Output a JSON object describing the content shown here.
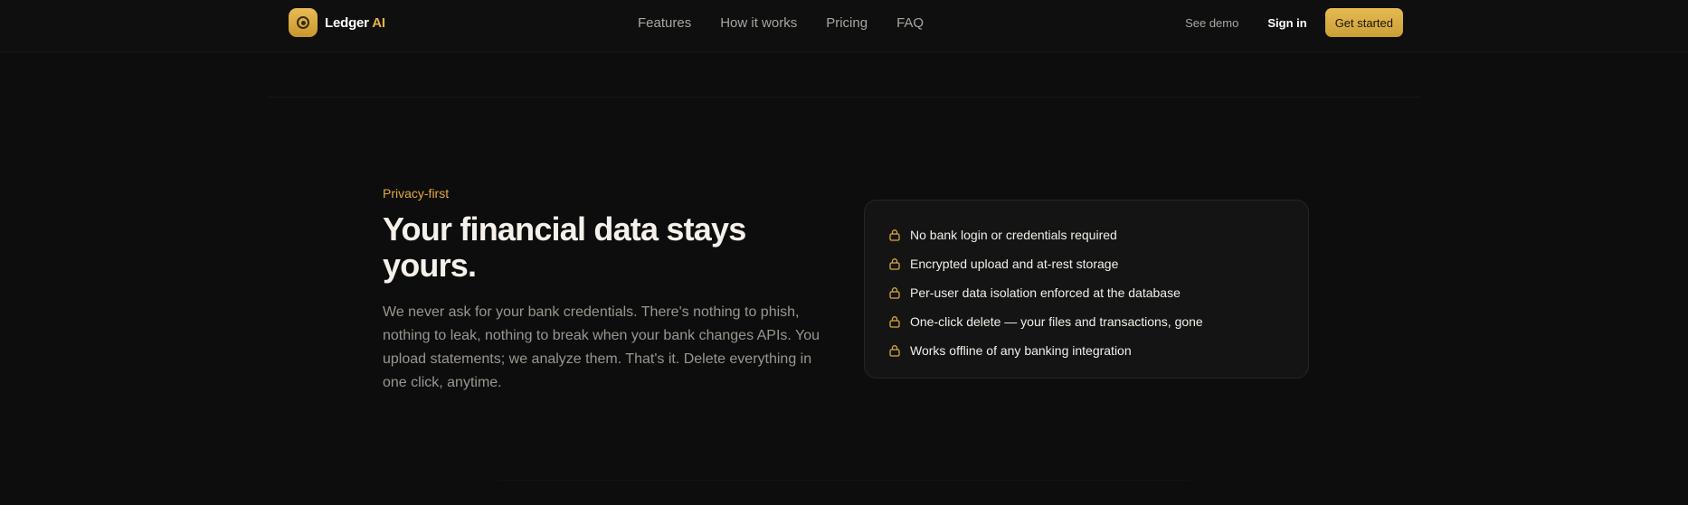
{
  "brand": {
    "name": "Ledger",
    "suffix": "AI"
  },
  "nav": {
    "items": [
      "Features",
      "How it works",
      "Pricing",
      "FAQ"
    ]
  },
  "header_actions": {
    "see_demo": "See demo",
    "sign_in": "Sign in",
    "get_started": "Get started"
  },
  "privacy": {
    "eyebrow": "Privacy-first",
    "headline": "Your financial data stays yours.",
    "body": "We never ask for your bank credentials. There's nothing to phish, nothing to leak, nothing to break when your bank changes APIs. You upload statements; we analyze them. That's it. Delete everything in one click, anytime.",
    "features": [
      "No bank login or credentials required",
      "Encrypted upload and at-rest storage",
      "Per-user data isolation enforced at the database",
      "One-click delete — your files and transactions, gone",
      "Works offline of any banking integration"
    ],
    "feature_icon": "lock-icon"
  },
  "colors": {
    "accent": "#e3b24a",
    "background": "#0d0d0d",
    "card": "#141414"
  }
}
